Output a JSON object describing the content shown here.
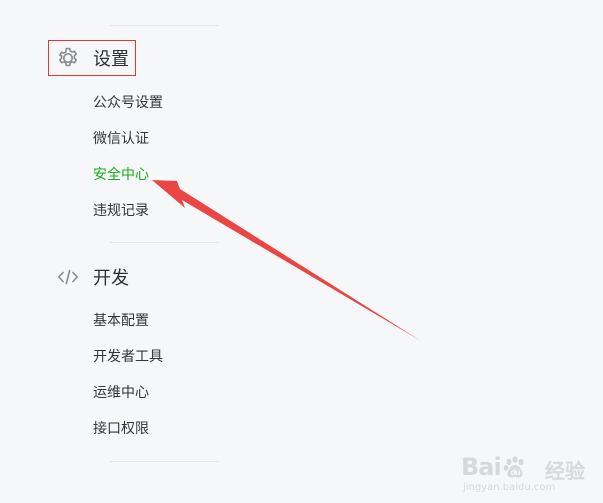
{
  "settings": {
    "title": "设置",
    "icon": "gear-icon",
    "items": [
      {
        "label": "公众号设置",
        "active": false
      },
      {
        "label": "微信认证",
        "active": false
      },
      {
        "label": "安全中心",
        "active": true
      },
      {
        "label": "违规记录",
        "active": false
      }
    ]
  },
  "develop": {
    "title": "开发",
    "icon": "code-icon",
    "items": [
      {
        "label": "基本配置",
        "active": false
      },
      {
        "label": "开发者工具",
        "active": false
      },
      {
        "label": "运维中心",
        "active": false
      },
      {
        "label": "接口权限",
        "active": false
      }
    ]
  },
  "annotation": {
    "arrow_color": "#e9413e",
    "box_color": "#e0373d"
  },
  "watermark": {
    "brand_prefix": "Bai",
    "brand_suffix": "经验",
    "url": "jingyan.baidu.com"
  },
  "colors": {
    "background": "#f6f7f9",
    "active_text": "#1aad19",
    "text": "#353535",
    "icon": "#8c8c8c"
  }
}
